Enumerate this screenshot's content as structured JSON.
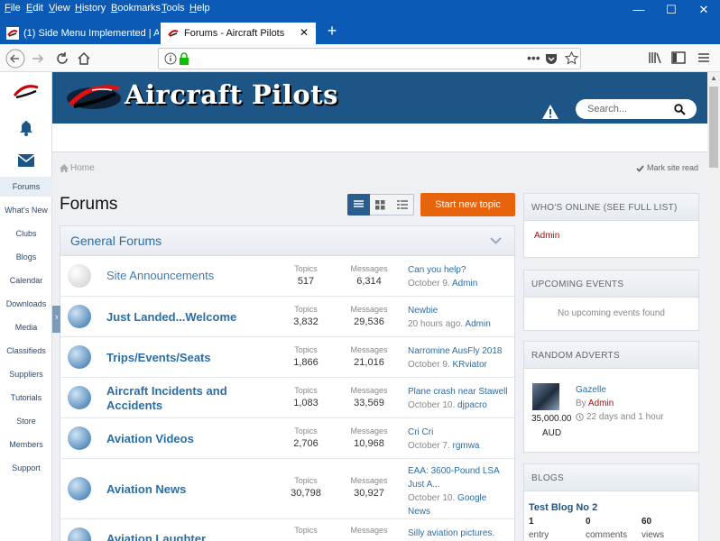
{
  "menubar": {
    "items": [
      "File",
      "Edit",
      "View",
      "History",
      "Bookmarks",
      "Tools",
      "Help"
    ],
    "underline": [
      "F",
      "E",
      "V",
      "H",
      "B",
      "T",
      "H"
    ],
    "rest": [
      "ile",
      "dit",
      "iew",
      "istory",
      "ookmarks",
      "ools",
      "elp"
    ]
  },
  "window_controls": {
    "minimize": "—",
    "maximize": "☐",
    "close": "✕"
  },
  "tabs": [
    {
      "title": "(1) Side Menu Implemented | A"
    },
    {
      "title": "Forums - Aircraft Pilots"
    }
  ],
  "newtab": "+",
  "sidebar": {
    "items": [
      "Forums",
      "What's New",
      "Clubs",
      "Blogs",
      "Calendar",
      "Downloads",
      "Media",
      "Classifieds",
      "Suppliers",
      "Tutorials",
      "Store",
      "Members",
      "Support"
    ]
  },
  "header": {
    "site_title": "Aircraft Pilots",
    "search_placeholder": "Search..."
  },
  "breadcrumb": {
    "home": "Home",
    "mark_read": "Mark site read"
  },
  "page": {
    "title": "Forums",
    "start_topic": "Start new topic"
  },
  "category": {
    "name": "General Forums"
  },
  "forums": [
    {
      "name": "Site Announcements",
      "topics_label": "Topics",
      "topics": "517",
      "messages_label": "Messages",
      "messages": "6,314",
      "last_title": "Can you help?",
      "last_date": "October 9.",
      "last_user": "Admin"
    },
    {
      "name": "Just Landed...Welcome",
      "topics_label": "Topics",
      "topics": "3,832",
      "messages_label": "Messages",
      "messages": "29,536",
      "last_title": "Newbie",
      "last_date": "20 hours ago.",
      "last_user": "Admin"
    },
    {
      "name": "Trips/Events/Seats",
      "topics_label": "Topics",
      "topics": "1,866",
      "messages_label": "Messages",
      "messages": "21,016",
      "last_title": "Narromine AusFly 2018",
      "last_date": "October 9.",
      "last_user": "KRviator"
    },
    {
      "name": "Aircraft Incidents and Accidents",
      "name_line1": "Aircraft Incidents and",
      "name_line2": "Accidents",
      "topics_label": "Topics",
      "topics": "1,083",
      "messages_label": "Messages",
      "messages": "33,569",
      "last_title": "Plane crash near Stawell",
      "last_date": "October 10.",
      "last_user": "djpacro"
    },
    {
      "name": "Aviation Videos",
      "topics_label": "Topics",
      "topics": "2,706",
      "messages_label": "Messages",
      "messages": "10,968",
      "last_title": "Cri Cri",
      "last_date": "October 7.",
      "last_user": "rgmwa"
    },
    {
      "name": "Aviation News",
      "topics_label": "Topics",
      "topics": "30,798",
      "messages_label": "Messages",
      "messages": "30,927",
      "last_title_line1": "EAA: 3600-Pound LSA",
      "last_title_line2": "Just A...",
      "last_date": "October 10.",
      "last_user_line1": "Google",
      "last_user_line2": "News"
    },
    {
      "name": "Aviation Laughter",
      "topics_label": "Topics",
      "topics": "",
      "messages_label": "Messages",
      "messages": "",
      "last_title": "Silly aviation pictures."
    }
  ],
  "panels": {
    "online": {
      "title": "WHO'S ONLINE (SEE FULL LIST)",
      "user": "Admin"
    },
    "events": {
      "title": "UPCOMING EVENTS",
      "empty": "No upcoming events found"
    },
    "adverts": {
      "title": "RANDOM ADVERTS",
      "item": "Gazelle",
      "by": "By",
      "author": "Admin",
      "time": "22 days and 1 hour",
      "price": "35,000.00",
      "currency": "AUD"
    },
    "blogs": {
      "title": "BLOGS",
      "item": "Test Blog No 2",
      "stats": [
        {
          "value": "1",
          "label": "entry"
        },
        {
          "value": "0",
          "label": "comments"
        },
        {
          "value": "60",
          "label": "views"
        }
      ]
    }
  },
  "colors": {
    "titlebar": "#0b5bb6",
    "banner": "#1d5686",
    "accent": "#e8640c",
    "link": "#2a6ea8",
    "admin": "#cc0000"
  }
}
